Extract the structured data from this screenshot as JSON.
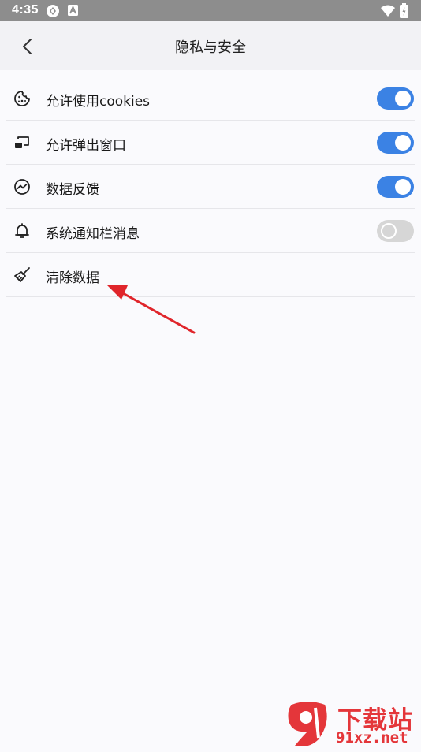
{
  "status_bar": {
    "time": "4:35",
    "icons": [
      "sync-icon",
      "a-badge-icon",
      "wifi-icon",
      "battery-icon"
    ]
  },
  "header": {
    "title": "隐私与安全",
    "back_icon": "chevron-left-icon"
  },
  "settings": [
    {
      "icon": "cookie-icon",
      "label": "允许使用cookies",
      "toggle": "on"
    },
    {
      "icon": "popup-window-icon",
      "label": "允许弹出窗口",
      "toggle": "on"
    },
    {
      "icon": "feedback-chart-icon",
      "label": "数据反馈",
      "toggle": "on"
    },
    {
      "icon": "bell-icon",
      "label": "系统通知栏消息",
      "toggle": "off"
    },
    {
      "icon": "broom-icon",
      "label": "清除数据",
      "toggle": null
    }
  ],
  "watermark": {
    "logo_text": "9",
    "title": "下载站",
    "url": "91xz.net"
  },
  "colors": {
    "accent": "#3b82e4",
    "status_bar": "#8d8d8d",
    "header_bg": "#f2f2f5",
    "page_bg": "#fafafd",
    "arrow": "#e0252b",
    "watermark": "#e4363a"
  }
}
